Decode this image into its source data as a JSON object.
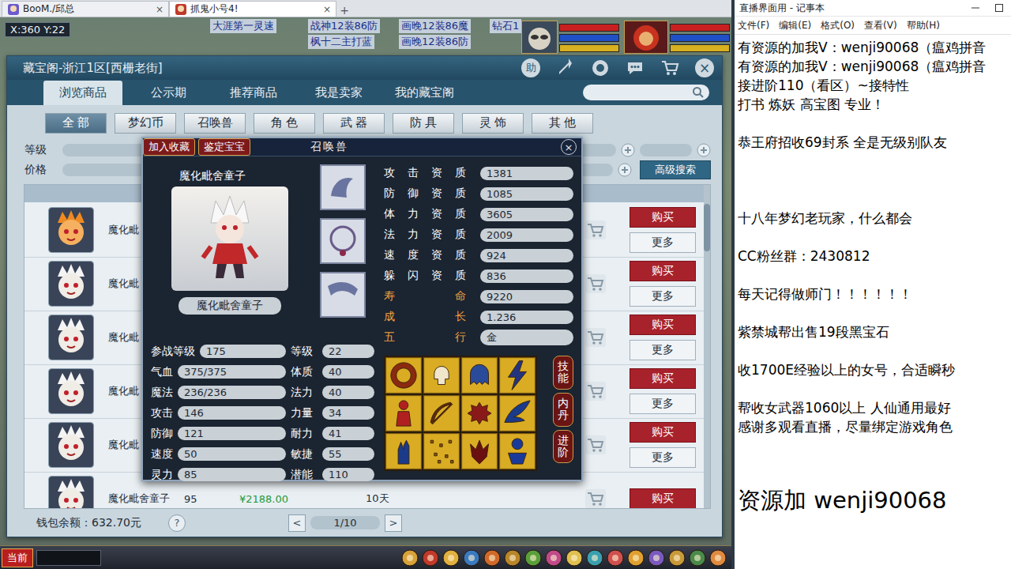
{
  "browser": {
    "tabs": [
      {
        "label": "BooM./邱总",
        "selected": false,
        "close": "×"
      },
      {
        "label": "抓鬼小号4!",
        "selected": true,
        "close": "×"
      }
    ],
    "new_tab": "+"
  },
  "hud": {
    "coords": "X:360 Y:22",
    "names": [
      "大涯第一灵速",
      "战神12装86防",
      "画晚12装86魔",
      "钻石1",
      "枫十二主打蓝",
      "画晚12装86防"
    ]
  },
  "dialog": {
    "title": "藏宝阁-浙江1区[西栅老街]",
    "help": "助",
    "close": "×",
    "tabs": [
      {
        "label": "浏览商品",
        "selected": true
      },
      {
        "label": "公示期",
        "selected": false
      },
      {
        "label": "推荐商品",
        "selected": false
      },
      {
        "label": "我是卖家",
        "selected": false
      },
      {
        "label": "我的藏宝阁",
        "selected": false
      }
    ],
    "categories": [
      {
        "label": "全 部",
        "selected": true
      },
      {
        "label": "梦幻币",
        "selected": false
      },
      {
        "label": "召唤兽",
        "selected": false
      },
      {
        "label": "角 色",
        "selected": false
      },
      {
        "label": "武 器",
        "selected": false
      },
      {
        "label": "防 具",
        "selected": false
      },
      {
        "label": "灵 饰",
        "selected": false
      },
      {
        "label": "其 他",
        "selected": false
      }
    ],
    "filters": [
      {
        "label": "等级"
      },
      {
        "label": "价格"
      }
    ],
    "advanced_search": "高级搜索",
    "rows": [
      {
        "name": "魔化毗",
        "kind": "fire",
        "buy": "购买",
        "more": "更多"
      },
      {
        "name": "魔化毗",
        "kind": "plain",
        "buy": "购买",
        "more": "更多"
      },
      {
        "name": "魔化毗",
        "kind": "plain",
        "buy": "购买",
        "more": "更多"
      },
      {
        "name": "魔化毗",
        "kind": "plain",
        "buy": "购买",
        "more": "更多"
      },
      {
        "name": "魔化毗",
        "kind": "plain",
        "buy": "购买",
        "more": "更多"
      },
      {
        "name": "魔化毗舍童子",
        "kind": "plain",
        "level": "95",
        "price": "¥2188.00",
        "time": "10天",
        "buy": "购买"
      }
    ],
    "wallet": "钱包余额：632.70元",
    "help_q": "?",
    "pager": {
      "prev": "<",
      "page": "1/10",
      "next": ">"
    }
  },
  "pet": {
    "favorite": "加入收藏",
    "appraise": "鉴定宝宝",
    "title": "召唤兽",
    "close": "×",
    "name": "魔化毗舍童子",
    "name_label": "魔化毗舍童子",
    "attributes": [
      {
        "label": "参战等级",
        "value": "175",
        "label2": "等级",
        "value2": "22"
      },
      {
        "label": "气血",
        "value": "375/375",
        "label2": "体质",
        "value2": "40"
      },
      {
        "label": "魔法",
        "value": "236/236",
        "label2": "法力",
        "value2": "40"
      },
      {
        "label": "攻击",
        "value": "146",
        "label2": "力量",
        "value2": "34"
      },
      {
        "label": "防御",
        "value": "121",
        "label2": "耐力",
        "value2": "41"
      },
      {
        "label": "速度",
        "value": "50",
        "label2": "敏捷",
        "value2": "55"
      },
      {
        "label": "灵力",
        "value": "85",
        "label2": "潜能",
        "value2": "110"
      }
    ],
    "aptitudes": [
      {
        "label": "攻击资质",
        "value": "1381",
        "highlight": false
      },
      {
        "label": "防御资质",
        "value": "1085",
        "highlight": false
      },
      {
        "label": "体力资质",
        "value": "3605",
        "highlight": false
      },
      {
        "label": "法力资质",
        "value": "2009",
        "highlight": false
      },
      {
        "label": "速度资质",
        "value": "924",
        "highlight": false
      },
      {
        "label": "躲闪资质",
        "value": "836",
        "highlight": false
      },
      {
        "label": "寿命",
        "value": "9220",
        "highlight": true
      },
      {
        "label": "成长",
        "value": "1.236",
        "highlight": true
      },
      {
        "label": "五行",
        "value": "金",
        "highlight": true
      }
    ],
    "side_tabs": [
      "技能",
      "内丹",
      "进阶"
    ]
  },
  "bottom_bar": {
    "channel": "当前"
  },
  "notepad": {
    "title": "直播界面用 - 记事本",
    "menu": [
      "文件(F)",
      "编辑(E)",
      "格式(O)",
      "查看(V)",
      "帮助(H)"
    ],
    "lines": [
      {
        "text": "有资源的加我V：wenji90068（瘟鸡拼音",
        "kind": "line"
      },
      {
        "text": "有资源的加我V：wenji90068（瘟鸡拼音",
        "kind": "line"
      },
      {
        "text": "接进阶110（看区）~接特性",
        "kind": "line"
      },
      {
        "text": "打书 炼妖 高宝图 专业！",
        "kind": "line"
      },
      {
        "text": "",
        "kind": "line"
      },
      {
        "text": "恭王府招收69封系 全是无级别队友",
        "kind": "line"
      },
      {
        "text": "",
        "kind": "line"
      },
      {
        "text": "",
        "kind": "line"
      },
      {
        "text": "",
        "kind": "line"
      },
      {
        "text": "十八年梦幻老玩家，什么都会",
        "kind": "line"
      },
      {
        "text": "",
        "kind": "line"
      },
      {
        "text": "CC粉丝群：2430812",
        "kind": "line"
      },
      {
        "text": "",
        "kind": "line"
      },
      {
        "text": "每天记得做师门！！！！！！",
        "kind": "line"
      },
      {
        "text": "",
        "kind": "line"
      },
      {
        "text": "紫禁城帮出售19段黑宝石",
        "kind": "line"
      },
      {
        "text": "",
        "kind": "line"
      },
      {
        "text": "收1700E经验以上的女号，合适瞬秒",
        "kind": "line"
      },
      {
        "text": "",
        "kind": "line"
      },
      {
        "text": "帮收女武器1060以上 人仙通用最好",
        "kind": "line"
      },
      {
        "text": "感谢多观看直播，尽量绑定游戏角色",
        "kind": "line"
      },
      {
        "text": "",
        "kind": "line"
      },
      {
        "text": "",
        "kind": "line"
      },
      {
        "text": "资源加 wenji90068",
        "kind": "big"
      }
    ]
  }
}
